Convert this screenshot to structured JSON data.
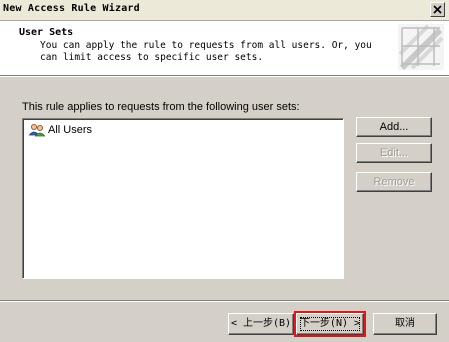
{
  "window": {
    "title": "New Access Rule Wizard"
  },
  "header": {
    "title": "User Sets",
    "description": "You can apply the rule to requests from all users. Or, you can limit access to specific user sets."
  },
  "main": {
    "rule_label": "This rule applies to requests from the following user sets:",
    "user_sets": [
      {
        "label": "All Users",
        "icon": "users-group-icon"
      }
    ],
    "buttons": {
      "add": "Add...",
      "edit": "Edit...",
      "remove": "Remove"
    }
  },
  "footer": {
    "back": "< 上一步(B)",
    "next": "下一步(N) >",
    "cancel": "取消"
  },
  "colors": {
    "highlight": "#e01818",
    "dialog_bg": "#d4d0c8"
  }
}
